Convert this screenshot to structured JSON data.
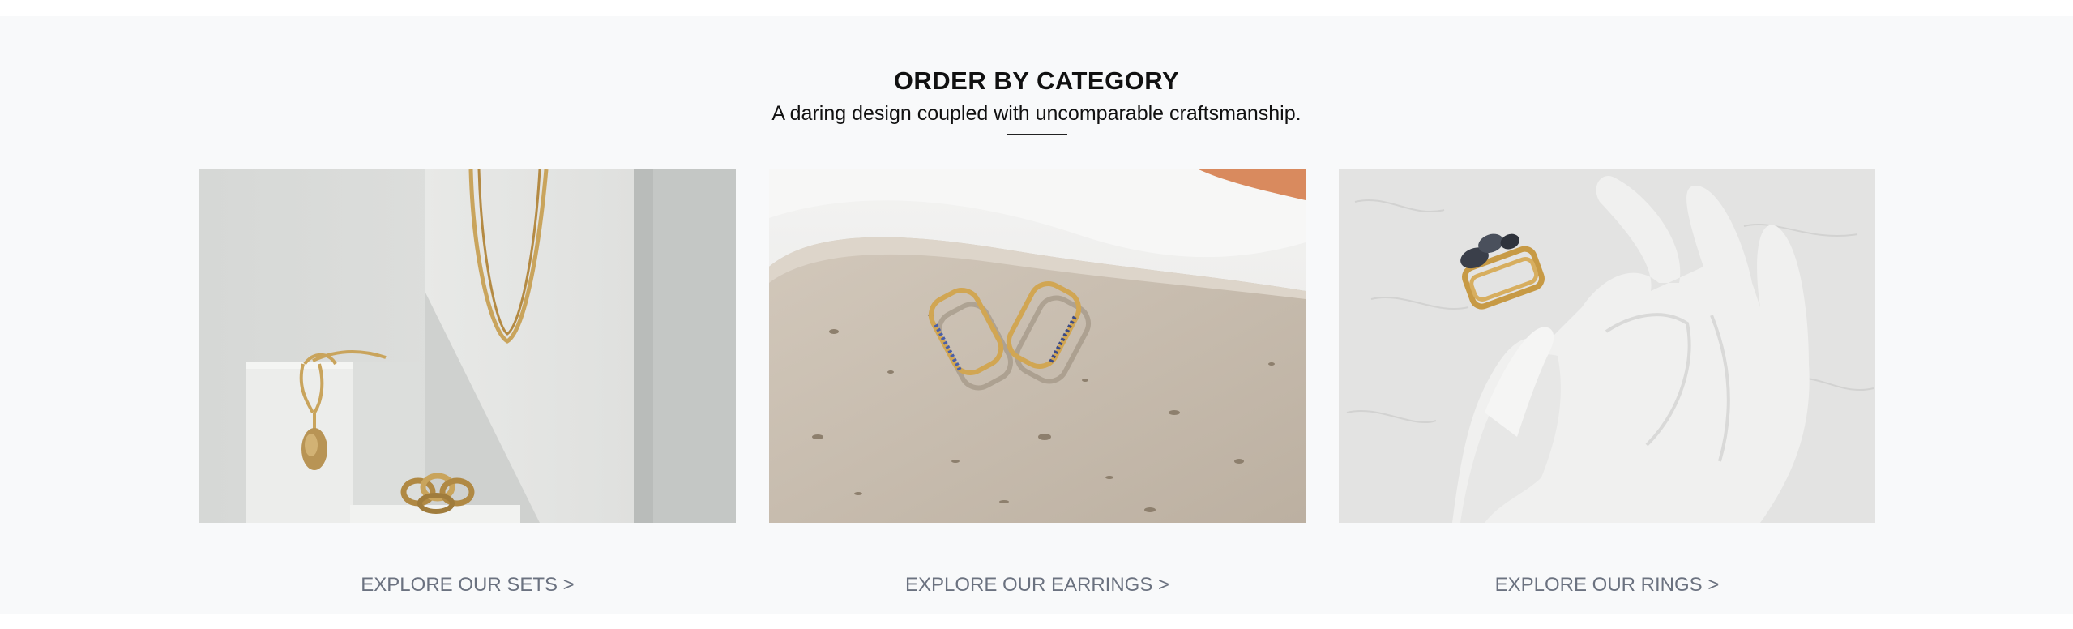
{
  "section": {
    "title": "ORDER BY CATEGORY",
    "subtitle": "A daring design coupled with uncomparable craftsmanship."
  },
  "categories": [
    {
      "link_label": "EXPLORE OUR SETS >",
      "image": "jewelry-sets-photo"
    },
    {
      "link_label": "EXPLORE OUR EARRINGS >",
      "image": "gold-hoop-earrings-photo"
    },
    {
      "link_label": "EXPLORE OUR RINGS >",
      "image": "gold-ring-on-hand-photo"
    }
  ],
  "colors": {
    "background": "#f8f9fa",
    "title": "#111111",
    "link": "#6b7280",
    "gold": "#c9a45c"
  }
}
